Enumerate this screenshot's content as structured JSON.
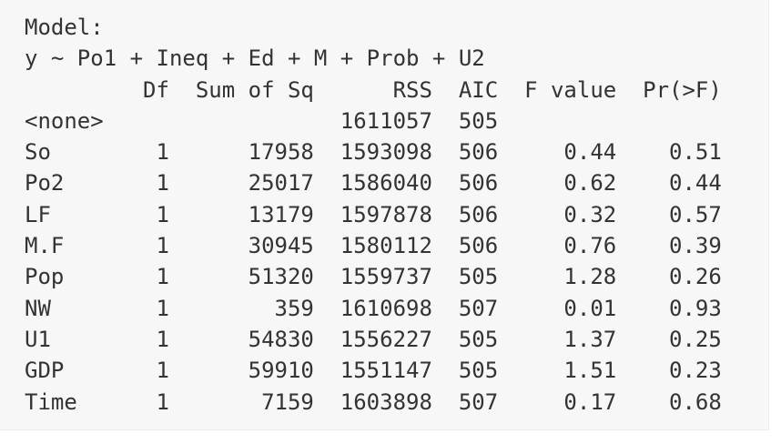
{
  "console": {
    "header": {
      "label": "Model:",
      "formula": "y ~ Po1 + Ineq + Ed + M + Prob + U2"
    },
    "table": {
      "columns": [
        "",
        "Df",
        "Sum of Sq",
        "RSS",
        "AIC",
        "F value",
        "Pr(>F)"
      ],
      "rows": [
        {
          "term": "<none>",
          "df": "",
          "sum_sq": "",
          "rss": "1611057",
          "aic": "505",
          "f_value": "",
          "p_value": ""
        },
        {
          "term": "So",
          "df": "1",
          "sum_sq": "17958",
          "rss": "1593098",
          "aic": "506",
          "f_value": "0.44",
          "p_value": "0.51"
        },
        {
          "term": "Po2",
          "df": "1",
          "sum_sq": "25017",
          "rss": "1586040",
          "aic": "506",
          "f_value": "0.62",
          "p_value": "0.44"
        },
        {
          "term": "LF",
          "df": "1",
          "sum_sq": "13179",
          "rss": "1597878",
          "aic": "506",
          "f_value": "0.32",
          "p_value": "0.57"
        },
        {
          "term": "M.F",
          "df": "1",
          "sum_sq": "30945",
          "rss": "1580112",
          "aic": "506",
          "f_value": "0.76",
          "p_value": "0.39"
        },
        {
          "term": "Pop",
          "df": "1",
          "sum_sq": "51320",
          "rss": "1559737",
          "aic": "505",
          "f_value": "1.28",
          "p_value": "0.26"
        },
        {
          "term": "NW",
          "df": "1",
          "sum_sq": "359",
          "rss": "1610698",
          "aic": "507",
          "f_value": "0.01",
          "p_value": "0.93"
        },
        {
          "term": "U1",
          "df": "1",
          "sum_sq": "54830",
          "rss": "1556227",
          "aic": "505",
          "f_value": "1.37",
          "p_value": "0.25"
        },
        {
          "term": "GDP",
          "df": "1",
          "sum_sq": "59910",
          "rss": "1551147",
          "aic": "505",
          "f_value": "1.51",
          "p_value": "0.23"
        },
        {
          "term": "Time",
          "df": "1",
          "sum_sq": "7159",
          "rss": "1603898",
          "aic": "507",
          "f_value": "0.17",
          "p_value": "0.68"
        }
      ]
    }
  }
}
